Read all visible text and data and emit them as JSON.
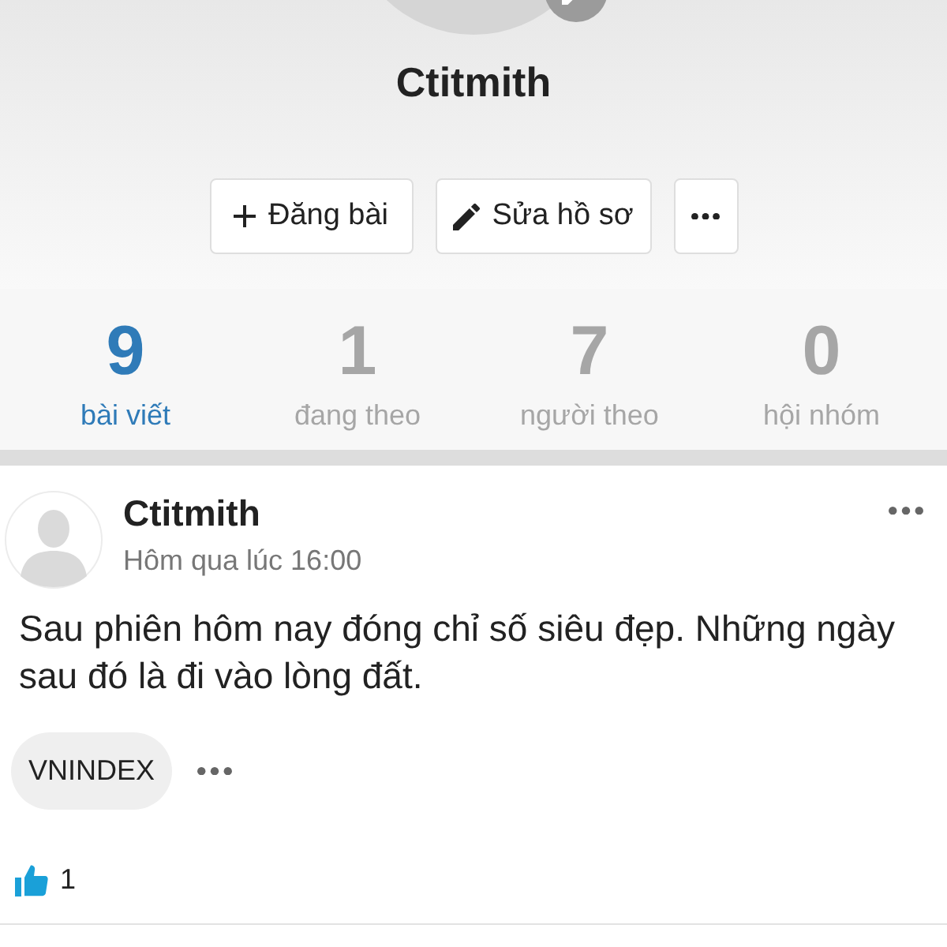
{
  "profile": {
    "name": "Ctitmith"
  },
  "actions": [
    {
      "kind": "add",
      "label": "Đăng bài"
    },
    {
      "kind": "edit",
      "label": "Sửa hồ sơ"
    },
    {
      "kind": "more"
    }
  ],
  "stats": [
    {
      "count": "9",
      "label": "bài viết",
      "selected": true
    },
    {
      "count": "1",
      "label": "đang theo",
      "selected": false
    },
    {
      "count": "7",
      "label": "người theo",
      "selected": false
    },
    {
      "count": "0",
      "label": "hội nhóm",
      "selected": false
    }
  ],
  "post": {
    "author": "Ctitmith",
    "time": "Hôm qua lúc 16:00",
    "body": "Sau phiên hôm nay đóng chỉ số siêu đẹp. Những ngày sau đó là đi vào lòng đất.",
    "tags": [
      "VNINDEX"
    ],
    "likes": "1"
  }
}
